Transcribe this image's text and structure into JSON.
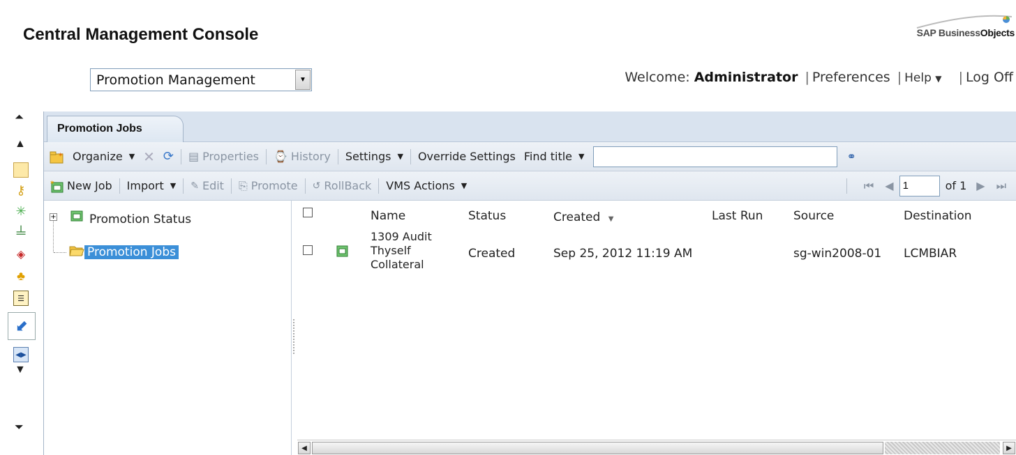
{
  "header": {
    "title": "Central Management Console",
    "logo_text_regular": "SAP Business",
    "logo_text_bold": "Objects"
  },
  "module_select": {
    "value": "Promotion Management"
  },
  "top_links": {
    "welcome_label": "Welcome:",
    "user": "Administrator",
    "preferences": "Preferences",
    "help": "Help",
    "log_off": "Log Off"
  },
  "tab": {
    "label": "Promotion Jobs"
  },
  "toolbar1": {
    "organize": "Organize",
    "properties": "Properties",
    "history": "History",
    "settings": "Settings",
    "override_settings": "Override Settings",
    "find_title": "Find title",
    "search_value": ""
  },
  "toolbar2": {
    "new_job": "New Job",
    "import": "Import",
    "edit": "Edit",
    "promote": "Promote",
    "rollback": "RollBack",
    "vms_actions": "VMS Actions"
  },
  "pager": {
    "page": "1",
    "of": "of 1"
  },
  "tree": {
    "items": [
      {
        "label": "Promotion Status"
      },
      {
        "label": "Promotion Jobs"
      }
    ]
  },
  "grid": {
    "columns": [
      "Name",
      "Status",
      "Created",
      "Last Run",
      "Source",
      "Destination"
    ],
    "rows": [
      {
        "name_line1": "1309 Audit",
        "name_line2": "Thyself",
        "name_line3": "Collateral",
        "status": "Created",
        "created": "Sep 25, 2012 11:19 AM",
        "last_run": "",
        "source": "sg-win2008-01",
        "destination": "LCMBIAR"
      }
    ]
  },
  "colors": {
    "accent": "#3b8fd8",
    "tabbar": "#d9e3ef",
    "toolbar": "#e6ecf3",
    "disabled_text": "#8a95a3"
  }
}
